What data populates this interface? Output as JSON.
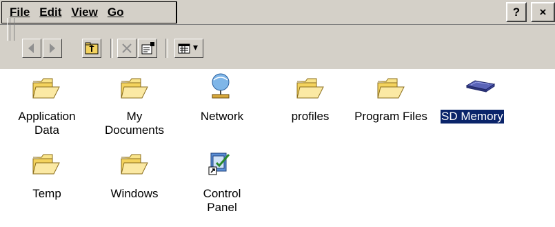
{
  "menu": {
    "file": "File",
    "edit": "Edit",
    "view": "View",
    "go": "Go"
  },
  "title_buttons": {
    "help": "?",
    "close": "×"
  },
  "toolbar": {
    "back_icon": "back-arrow-icon",
    "forward_icon": "forward-arrow-icon",
    "up_icon": "up-folder-icon",
    "delete_icon": "delete-x-icon",
    "properties_icon": "properties-icon",
    "views_icon": "view-list-icon",
    "views_dropdown": "▾"
  },
  "items": [
    {
      "label_line1": "Application",
      "label_line2": "Data",
      "icon": "folder-icon"
    },
    {
      "label_line1": "My",
      "label_line2": "Documents",
      "icon": "folder-icon"
    },
    {
      "label_line1": "Network",
      "label_line2": "",
      "icon": "network-icon"
    },
    {
      "label_line1": "profiles",
      "label_line2": "",
      "icon": "folder-icon"
    },
    {
      "label_line1": "Program Files",
      "label_line2": "",
      "icon": "folder-icon"
    },
    {
      "label_line1": "SD Memory",
      "label_line2": "",
      "icon": "storage-card-icon",
      "selected": true
    },
    {
      "label_line1": "Temp",
      "label_line2": "",
      "icon": "folder-icon"
    },
    {
      "label_line1": "Windows",
      "label_line2": "",
      "icon": "folder-icon"
    },
    {
      "label_line1": "Control",
      "label_line2": "Panel",
      "icon": "control-panel-shortcut-icon"
    }
  ],
  "colors": {
    "chrome": "#d4d0c8",
    "selection": "#0a246a",
    "folder": "#f4d35e"
  }
}
